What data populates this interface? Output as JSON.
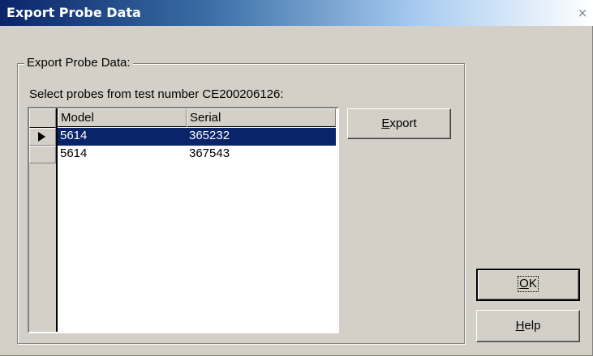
{
  "window": {
    "title": "Export Probe Data",
    "close_glyph": "×"
  },
  "group": {
    "label": "Export Probe Data:",
    "instruction": "Select probes from test number CE200206126:"
  },
  "table": {
    "columns": [
      "Model",
      "Serial"
    ],
    "rows": [
      {
        "model": "5614",
        "serial": "365232",
        "selected": true
      },
      {
        "model": "5614",
        "serial": "367543",
        "selected": false
      }
    ]
  },
  "buttons": {
    "export": {
      "mnemonic": "E",
      "rest": "xport"
    },
    "ok": {
      "mnemonic": "O",
      "rest": "K"
    },
    "help": {
      "mnemonic": "H",
      "rest": "elp"
    }
  },
  "colors": {
    "selection": "#0a246a",
    "dialog_face": "#d4d0c8"
  }
}
